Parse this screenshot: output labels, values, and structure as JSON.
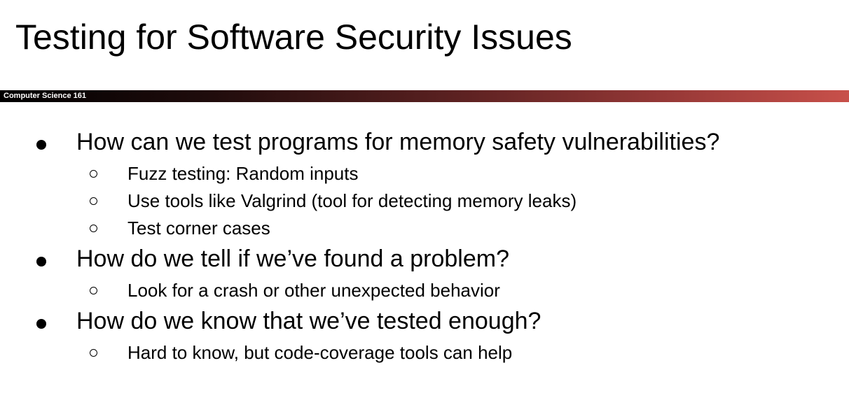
{
  "slide": {
    "title": "Testing for Software Security Issues",
    "course_label": "Computer Science 161"
  },
  "bullets": [
    {
      "text": "How can we test programs for memory safety vulnerabilities?",
      "sub": [
        {
          "text": "Fuzz testing: Random inputs"
        },
        {
          "text": "Use tools like Valgrind (tool for detecting memory leaks)"
        },
        {
          "text": "Test corner cases"
        }
      ]
    },
    {
      "text": "How do we tell if we’ve found a problem?",
      "sub": [
        {
          "text": "Look for a crash or other unexpected behavior"
        }
      ]
    },
    {
      "text": "How do we know that we’ve tested enough?",
      "sub": [
        {
          "text": "Hard to know, but code-coverage tools can help"
        }
      ]
    }
  ]
}
